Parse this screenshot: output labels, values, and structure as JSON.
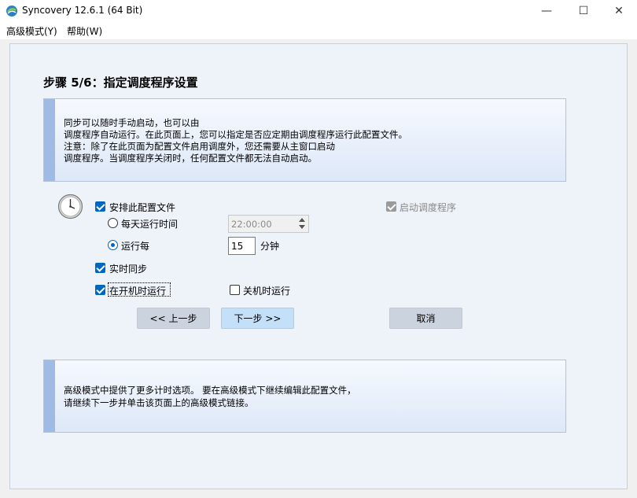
{
  "window": {
    "title": "Syncovery 12.6.1 (64 Bit)",
    "minimize_glyph": "—",
    "maximize_glyph": "☐",
    "close_glyph": "✕"
  },
  "menu": {
    "items": [
      "高级模式(Y)",
      "帮助(W)"
    ]
  },
  "page": {
    "heading": "步骤 5/6：指定调度程序设置",
    "info_top": [
      "同步可以随时手动启动，也可以由",
      "调度程序自动运行。在此页面上，您可以指定是否应定期由调度程序运行此配置文件。",
      "注意：除了在此页面为配置文件启用调度外，您还需要从主窗口启动",
      "调度程序。当调度程序关闭时，任何配置文件都无法自动启动。"
    ],
    "info_bottom": [
      "高级模式中提供了更多计时选项。 要在高级模式下继续编辑此配置文件，",
      "请继续下一步并单击该页面上的高级模式链接。"
    ]
  },
  "schedule": {
    "schedule_profile_label": "安排此配置文件",
    "schedule_profile_checked": true,
    "daily_label": "每天运行时间",
    "daily_selected": false,
    "daily_time": "22:00:00",
    "every_label": "运行每",
    "every_selected": true,
    "every_value": "15",
    "every_unit": "分钟",
    "realtime_label": "实时同步",
    "realtime_checked": true,
    "startup_label": "在开机时运行",
    "startup_checked": true,
    "shutdown_label": "关机时运行",
    "shutdown_checked": false,
    "start_scheduler_label": "启动调度程序",
    "start_scheduler_checked": true
  },
  "buttons": {
    "prev": "<< 上一步",
    "next": "下一步 >>",
    "cancel": "取消"
  },
  "colors": {
    "accent": "#0067c0",
    "info_accent": "#9fbae3",
    "next_button": "#c4dff8"
  },
  "icons": {
    "app": "syncovery-logo-icon",
    "clock": "clock-icon"
  }
}
